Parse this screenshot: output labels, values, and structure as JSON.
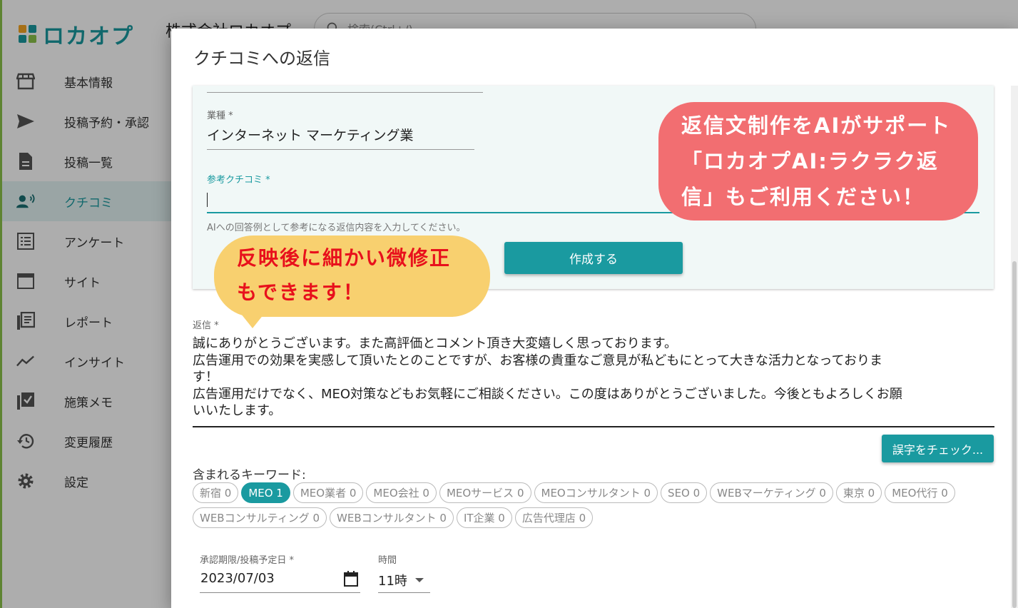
{
  "app": {
    "logo_text": "ロカオプ",
    "company": "株式会社ロカオプ",
    "search_placeholder": "検索(Ctrl+/)"
  },
  "sidebar": {
    "items": [
      {
        "label": "基本情報",
        "icon": "store-icon"
      },
      {
        "label": "投稿予約・承認",
        "icon": "send-icon"
      },
      {
        "label": "投稿一覧",
        "icon": "document-icon"
      },
      {
        "label": "クチコミ",
        "icon": "review-voice-icon",
        "active": true
      },
      {
        "label": "アンケート",
        "icon": "list-icon"
      },
      {
        "label": "サイト",
        "icon": "browser-window-icon"
      },
      {
        "label": "レポート",
        "icon": "report-icon"
      },
      {
        "label": "インサイト",
        "icon": "trend-line-icon"
      },
      {
        "label": "施策メモ",
        "icon": "checklist-icon"
      },
      {
        "label": "変更履歴",
        "icon": "history-icon"
      },
      {
        "label": "設定",
        "icon": "gear-icon"
      }
    ]
  },
  "dialog": {
    "title": "クチコミへの返信",
    "ai_panel": {
      "industry_label": "業種 *",
      "industry_value": "インターネット マーケティング業",
      "reference_label": "参考クチコミ *",
      "reference_value": "",
      "reference_hint": "AIへの回答例として参考になる返信内容を入力してください。",
      "create_button": "作成する"
    },
    "reply": {
      "label": "返信 *",
      "lines": [
        "誠にありがとうございます。また高評価とコメント頂き大変嬉しく思っております。",
        "広告運用での効果を実感して頂いたとのことですが、お客様の貴重なご意見が私どもにとって大きな活力となっておりま",
        "す！",
        "広告運用だけでなく、MEO対策などもお気軽にご相談ください。この度はありがとうございました。今後ともよろしくお願",
        "いいたします。"
      ]
    },
    "typo_check_button": "誤字をチェック...",
    "keywords_label": "含まれるキーワード:",
    "keywords": [
      {
        "label": "新宿 0",
        "selected": false
      },
      {
        "label": "MEO 1",
        "selected": true
      },
      {
        "label": "MEO業者 0",
        "selected": false
      },
      {
        "label": "MEO会社 0",
        "selected": false
      },
      {
        "label": "MEOサービス 0",
        "selected": false
      },
      {
        "label": "MEOコンサルタント 0",
        "selected": false
      },
      {
        "label": "SEO 0",
        "selected": false
      },
      {
        "label": "WEBマーケティング 0",
        "selected": false
      },
      {
        "label": "東京 0",
        "selected": false
      },
      {
        "label": "MEO代行 0",
        "selected": false
      },
      {
        "label": "WEBコンサルティング 0",
        "selected": false
      },
      {
        "label": "WEBコンサルタント 0",
        "selected": false
      },
      {
        "label": "IT企業 0",
        "selected": false
      },
      {
        "label": "広告代理店 0",
        "selected": false
      }
    ],
    "date_label": "承認期限/投稿予定日 *",
    "date_value": "2023/07/03",
    "time_label": "時間",
    "time_value": "11時"
  },
  "callouts": {
    "red_lines": [
      "返信文制作をAIがサポート",
      "「ロカオプAI:ラクラク返",
      "信」もご利用ください！"
    ],
    "yellow_lines": [
      "反映後に細かい微修正",
      "もできます！"
    ]
  },
  "colors": {
    "accent": "#1a9aa0",
    "callout_red": "#f26e71",
    "callout_yellow": "#f8d06f",
    "callout_yellow_text": "#e8101c"
  }
}
